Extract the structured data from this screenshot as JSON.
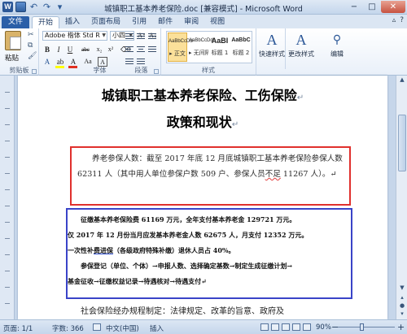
{
  "window": {
    "title": "城镇职工基本养老保险.doc [兼容模式] - Microsoft Word",
    "minimize": "−",
    "maximize": "□",
    "close": "✕"
  },
  "tabs": {
    "file": "文件",
    "items": [
      "开始",
      "插入",
      "页面布局",
      "引用",
      "邮件",
      "审阅",
      "视图"
    ],
    "active": "开始"
  },
  "ribbon": {
    "clipboard": {
      "paste": "粘贴",
      "group": "剪贴板"
    },
    "font": {
      "font_name": "Adobe 楷体 Std R",
      "font_size": "小四",
      "aa_glyph": "Aa",
      "bold": "B",
      "italic": "I",
      "underline": "U",
      "strike": "abc",
      "group": "字体",
      "highlight_color": "#ffff00",
      "font_color": "#e03020"
    },
    "paragraph": {
      "group": "段落"
    },
    "styles": {
      "items": [
        {
          "sample": "AaBbCcDd",
          "name": "▸ 正文"
        },
        {
          "sample": "AaBbCcDd",
          "name": "▸ 无间隔"
        },
        {
          "sample": "AaBI",
          "name": "标题 1"
        },
        {
          "sample": "AaBbC",
          "name": "标题 2"
        }
      ],
      "group": "样式"
    },
    "quick_styles": "快速样式",
    "change_styles": "更改样式",
    "editing": "编辑"
  },
  "document": {
    "title_line1": "城镇职工基本养老保险、工伤保险",
    "title_line2": "政策和现状",
    "pilcrow": "↵",
    "p1_a": "养老参保人数：截至 2017 年底 12 月底城镇职工基本养老保险参保人数 62311 人（其中用人单位参保户数 509 户、参保人员",
    "p1_b": "不足",
    "p1_c": " 11267 人）。↵",
    "p2_line1": "征缴基本养老保险费 61169 万元，全年支付基本养老金 129721 万元。",
    "p2_line2": "仅 2017 年 12 月份当月应发基本养老金人数 62675 人，月支付 12352 万元。",
    "p2_line3_a": "一次性补",
    "p2_line3_b": "费进保",
    "p2_line3_c": "（各级政府特殊补缴）退休人员占 40%。",
    "p2_line4": "参保登记（单位、个体）→申报人数、选择确定基数→制定生成征缴计划→",
    "p2_line5": "基金征收→征缴权益记录→待遇核对→待遇支付↵",
    "p3": "社会保险经办规程制定：法律规定、改革的旨意、政府及"
  },
  "status": {
    "page": "页面: 1/1",
    "words": "字数: 366",
    "language": "中文(中国)",
    "mode": "插入",
    "zoom": "90%",
    "zoom_out": "−",
    "zoom_in": "+"
  }
}
